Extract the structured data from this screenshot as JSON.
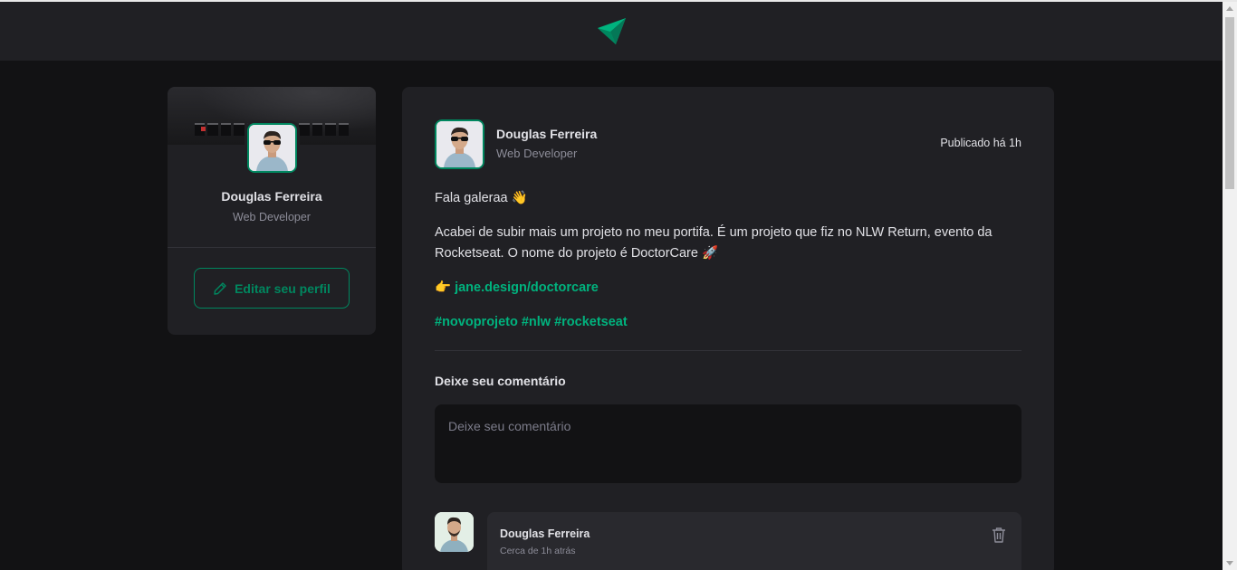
{
  "header": {
    "logo_icon": "ignite-feed-logo-icon"
  },
  "colors": {
    "brand": "#00875f",
    "brand_light": "#00b37e",
    "background": "#121214",
    "surface": "#202024"
  },
  "sidebar": {
    "name": "Douglas Ferreira",
    "role": "Web Developer",
    "edit_button_label": "Editar seu perfil",
    "edit_icon": "pencil-icon"
  },
  "post": {
    "author_name": "Douglas Ferreira",
    "author_role": "Web Developer",
    "published": "Publicado há 1h",
    "greeting": "Fala galeraa 👋",
    "body": "Acabei de subir mais um projeto no meu portifa. É um projeto que fiz no NLW Return, evento da Rocketseat. O nome do projeto é DoctorCare 🚀",
    "link_prefix": "👉 ",
    "link_text": "jane.design/doctorcare",
    "hashtags": [
      "#novoprojeto",
      "#nlw",
      "#rocketseat"
    ],
    "comment_section_title": "Deixe seu comentário",
    "comment_placeholder": "Deixe seu comentário"
  },
  "comments": [
    {
      "author": "Douglas Ferreira",
      "time": "Cerca de 1h atrás",
      "delete_icon": "trash-icon"
    }
  ]
}
